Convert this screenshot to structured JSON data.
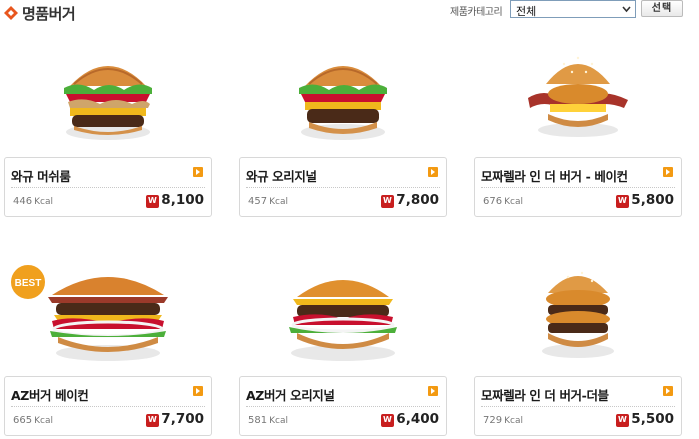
{
  "header": {
    "title": "명품버거",
    "category_label": "제품카테고리",
    "category_value": "전체",
    "select_button": "선택"
  },
  "colors": {
    "accent_orange": "#f39a12",
    "won_red": "#c81e1e"
  },
  "badge": {
    "text": "BEST"
  },
  "products": [
    {
      "name": "와규 머쉬룸",
      "kcal": "446",
      "kcal_unit": "Kcal",
      "price": "8,100",
      "image": "mushroom-burger"
    },
    {
      "name": "와규 오리지널",
      "kcal": "457",
      "kcal_unit": "Kcal",
      "price": "7,800",
      "image": "original-burger"
    },
    {
      "name": "모짜렐라 인 더 버거 - 베이컨",
      "kcal": "676",
      "kcal_unit": "Kcal",
      "price": "5,800",
      "image": "mozzarella-bacon-burger"
    },
    {
      "name": "AZ버거 베이컨",
      "kcal": "665",
      "kcal_unit": "Kcal",
      "price": "7,700",
      "image": "az-bacon-burger"
    },
    {
      "name": "AZ버거 오리지널",
      "kcal": "581",
      "kcal_unit": "Kcal",
      "price": "6,400",
      "image": "az-original-burger"
    },
    {
      "name": "모짜렐라 인 더 버거-더블",
      "kcal": "729",
      "kcal_unit": "Kcal",
      "price": "5,500",
      "image": "mozzarella-double-burger"
    }
  ]
}
